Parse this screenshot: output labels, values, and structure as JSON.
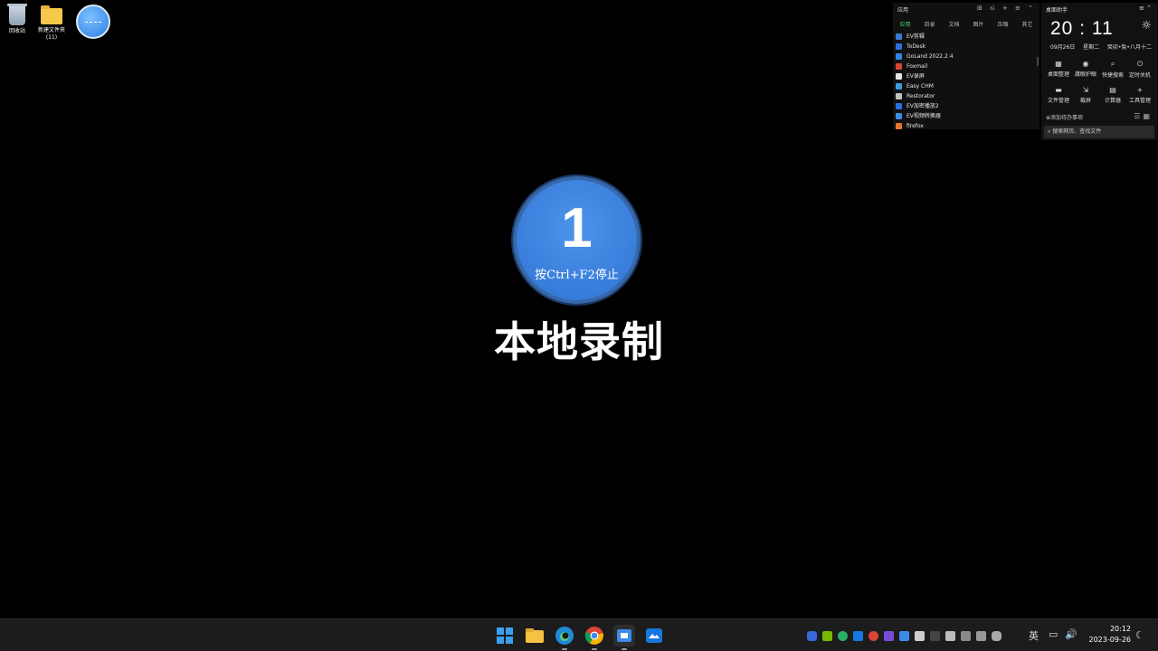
{
  "desktop": {
    "icons": [
      {
        "label": "回收站"
      },
      {
        "label": "新建文件夹",
        "sublabel": "(11)"
      }
    ]
  },
  "launcher": {
    "title": "应用",
    "tools": "⊞ ⎌ + ≡ ⌃",
    "tabs": [
      "应用",
      "目录",
      "文档",
      "图片",
      "压缩",
      "其它"
    ],
    "apps": [
      {
        "name": "EV剪辑",
        "color": "#3a7bd5"
      },
      {
        "name": "ToDesk",
        "color": "#2a6fe0"
      },
      {
        "name": "GoLand 2022.2.4",
        "color": "#2d86e8"
      },
      {
        "name": "Foxmail",
        "color": "#d8452f"
      },
      {
        "name": "EV录屏",
        "color": "#e6e6e6"
      },
      {
        "name": "Easy CHM",
        "color": "#3c9be0"
      },
      {
        "name": "Restorator",
        "color": "#c0c0c0"
      },
      {
        "name": "EV加密播放2",
        "color": "#2a6fe0"
      },
      {
        "name": "EV视频转换器",
        "color": "#3b8be8"
      },
      {
        "name": "firefox",
        "color": "#e8762d"
      }
    ]
  },
  "assistant": {
    "title": "桌面助手",
    "menu": "≡ ⌃",
    "clock": "20 : 11",
    "date": "09月26日",
    "weekday": "星期二",
    "lunar": "癸卯•兔•八月十二",
    "tools": [
      {
        "icon": "▦",
        "label": "桌面整理"
      },
      {
        "icon": "◉",
        "label": "護眼护眼"
      },
      {
        "icon": "⌕",
        "label": "快捷搜索"
      },
      {
        "icon": "⏻",
        "label": "定时关机"
      },
      {
        "icon": "▬",
        "label": "文件管理"
      },
      {
        "icon": "⇲",
        "label": "截屏"
      },
      {
        "icon": "▤",
        "label": "计算器"
      },
      {
        "icon": "+",
        "label": "工具管理"
      }
    ],
    "todo": "⊕添加待办事项",
    "search_placeholder": "搜索网页、查找文件"
  },
  "countdown": {
    "number": "1",
    "hint": "按Ctrl+F2停止"
  },
  "record_label": "本地录制",
  "taskbar": {
    "ime": "英",
    "time": "20:12",
    "date": "2023-09-26"
  }
}
